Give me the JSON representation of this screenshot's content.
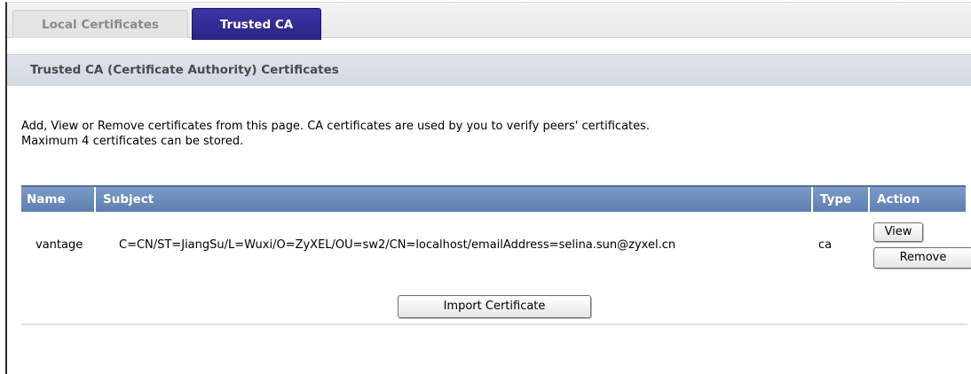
{
  "tabs": {
    "local": "Local Certificates",
    "trusted": "Trusted CA"
  },
  "section": {
    "title": "Trusted CA (Certificate Authority) Certificates"
  },
  "description": {
    "line1": "Add, View or Remove certificates from this page. CA certificates are used by you to verify peers' certificates.",
    "line2": "Maximum 4 certificates can be stored."
  },
  "table": {
    "headers": {
      "name": "Name",
      "subject": "Subject",
      "type": "Type",
      "action": "Action"
    },
    "rows": [
      {
        "name": "vantage",
        "subject": "C=CN/ST=JiangSu/L=Wuxi/O=ZyXEL/OU=sw2/CN=localhost/emailAddress=selina.sun@zyxel.cn",
        "type": "ca",
        "view_label": "View",
        "remove_label": "Remove"
      }
    ]
  },
  "buttons": {
    "import": "Import Certificate"
  },
  "colors": {
    "active_tab": "#2a2384",
    "table_header": "#6a8abb",
    "section_band": "#d8dee6"
  }
}
